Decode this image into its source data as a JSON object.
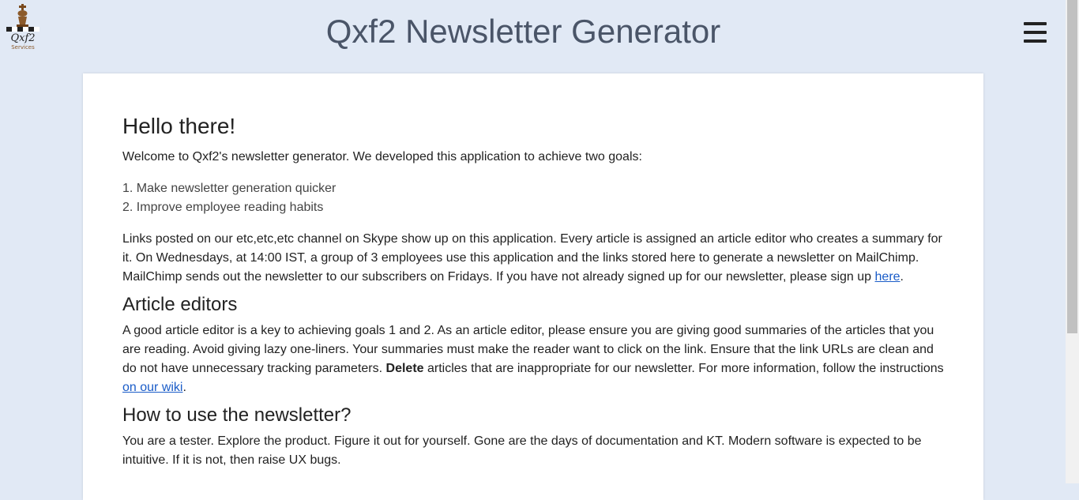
{
  "header": {
    "title": "Qxf2 Newsletter Generator",
    "logo_text": "Qxf2",
    "logo_subtext": "Services"
  },
  "intro": {
    "heading": "Hello there!",
    "welcome": "Welcome to Qxf2's newsletter generator. We developed this application to achieve two goals:",
    "goals": [
      "1. Make newsletter generation quicker",
      "2. Improve employee reading habits"
    ],
    "links_text": "Links posted on our etc,etc,etc channel on Skype show up on this application. Every article is assigned an article editor who creates a summary for it. On Wednesdays, at 14:00 IST, a group of 3 employees use this application and the links stored here to generate a newsletter on MailChimp. MailChimp sends out the newsletter to our subscribers on Fridays. If you have not already signed up for our newsletter, please sign up ",
    "signup_link": "here",
    "signup_end": "."
  },
  "editors": {
    "heading": "Article editors",
    "text_before": "A good article editor is a key to achieving goals 1 and 2. As an article editor, please ensure you are giving good summaries of the articles that you are reading. Avoid giving lazy one-liners. Your summaries must make the reader want to click on the link. Ensure that the link URLs are clean and do not have unnecessary tracking parameters. ",
    "bold": "Delete",
    "text_after": " articles that are inappropriate for our newsletter. For more information, follow the instructions ",
    "wiki_link": "on our wiki",
    "text_end": "."
  },
  "usage": {
    "heading": "How to use the newsletter?",
    "text": "You are a tester. Explore the product. Figure it out for yourself. Gone are the days of documentation and KT. Modern software is expected to be intuitive. If it is not, then raise UX bugs."
  },
  "colors": {
    "background": "#e1e9f5",
    "title": "#4a5568",
    "link": "#1a5cc8"
  }
}
